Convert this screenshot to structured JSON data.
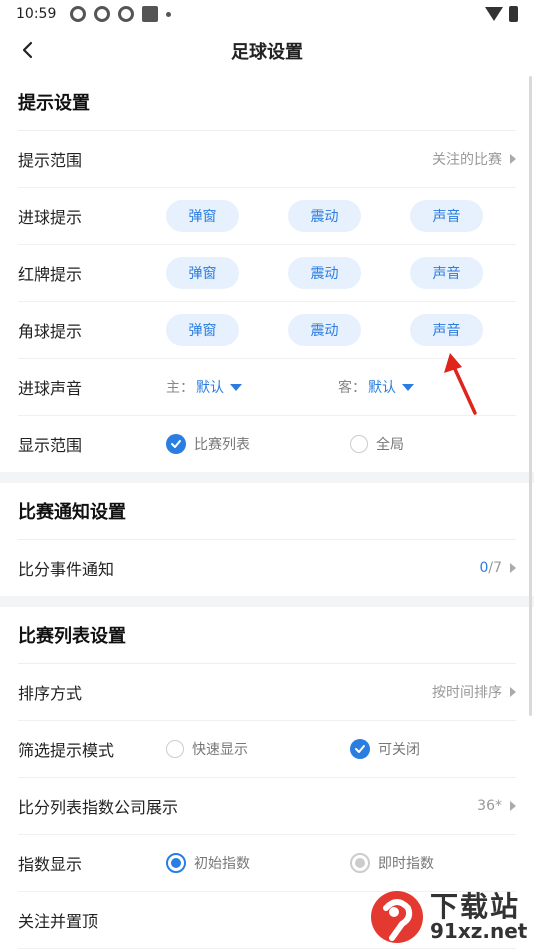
{
  "status": {
    "time": "10:59"
  },
  "header": {
    "title": "足球设置"
  },
  "section1": {
    "title": "提示设置",
    "scope": {
      "label": "提示范围",
      "value": "关注的比赛"
    },
    "goal": {
      "label": "进球提示",
      "opts": [
        "弹窗",
        "震动",
        "声音"
      ]
    },
    "red": {
      "label": "红牌提示",
      "opts": [
        "弹窗",
        "震动",
        "声音"
      ]
    },
    "corner": {
      "label": "角球提示",
      "opts": [
        "弹窗",
        "震动",
        "声音"
      ]
    },
    "sound": {
      "label": "进球声音",
      "home_key": "主：",
      "home_val": "默认",
      "away_key": "客：",
      "away_val": "默认"
    },
    "display": {
      "label": "显示范围",
      "opt1": "比赛列表",
      "opt2": "全局"
    }
  },
  "section2": {
    "title": "比赛通知设置",
    "score": {
      "label": "比分事件通知",
      "count": "0",
      "total": "/7"
    }
  },
  "section3": {
    "title": "比赛列表设置",
    "sort": {
      "label": "排序方式",
      "value": "按时间排序"
    },
    "filter": {
      "label": "筛选提示模式",
      "opt1": "快速显示",
      "opt2": "可关闭"
    },
    "company": {
      "label": "比分列表指数公司展示",
      "value": "36*"
    },
    "index": {
      "label": "指数显示",
      "opt1": "初始指数",
      "opt2": "即时指数"
    },
    "follow": {
      "label": "关注并置顶"
    }
  },
  "watermark": {
    "line1": "下载站",
    "line2": "91xz.net"
  },
  "colors": {
    "accent": "#2a7de1",
    "pill_bg": "#e7f1fd",
    "annotation_arrow": "#e0241b"
  }
}
